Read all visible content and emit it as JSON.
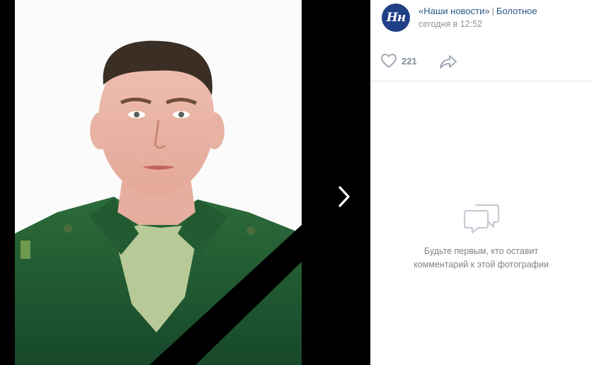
{
  "post": {
    "author_name": "«Наши новости»",
    "separator": "|",
    "location": "Болотное",
    "timestamp": "сегодня в 12:52",
    "avatar_text": "Нн"
  },
  "actions": {
    "like_count": "221",
    "like_icon": "heart-icon",
    "share_icon": "share-arrow-icon"
  },
  "comments": {
    "empty_line1": "Будьте первым, кто оставит",
    "empty_line2": "комментарий к этой фотографии",
    "empty_icon": "speech-bubbles-icon"
  },
  "viewer": {
    "next_icon": "chevron-right-icon"
  },
  "colors": {
    "link": "#2a5885",
    "muted": "#939393",
    "avatar_bg": "#1f3f86",
    "uniform": "#1f5a2e",
    "mourning_band": "#000000"
  }
}
